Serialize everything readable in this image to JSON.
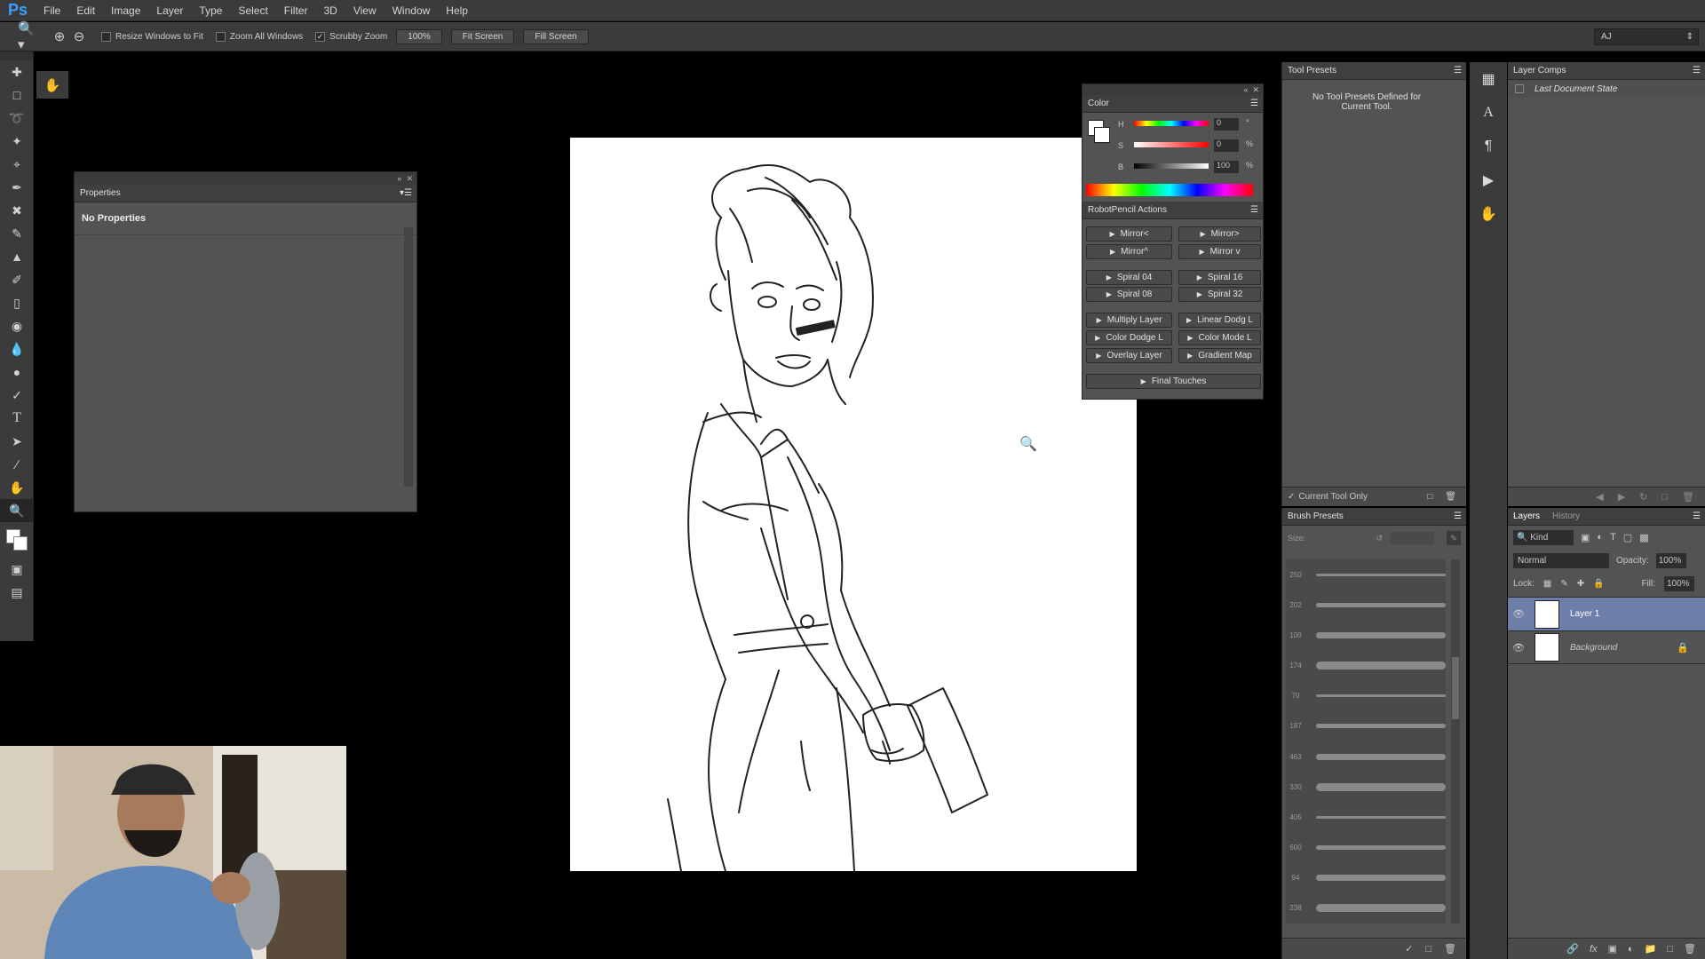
{
  "app": {
    "logo": "Ps"
  },
  "menu": [
    "File",
    "Edit",
    "Image",
    "Layer",
    "Type",
    "Select",
    "Filter",
    "3D",
    "View",
    "Window",
    "Help"
  ],
  "options": {
    "resize_windows": "Resize Windows to Fit",
    "zoom_all": "Zoom All Windows",
    "scrubby_zoom": "Scrubby Zoom",
    "zoom_level": "100%",
    "fit_screen": "Fit Screen",
    "fill_screen": "Fill Screen",
    "workspace": "AJ"
  },
  "properties": {
    "title": "Properties",
    "content": "No Properties"
  },
  "color": {
    "title": "Color",
    "h_label": "H",
    "h_value": "0",
    "h_unit": "°",
    "s_label": "S",
    "s_value": "0",
    "s_unit": "%",
    "b_label": "B",
    "b_value": "100",
    "b_unit": "%"
  },
  "actions": {
    "title": "RobotPencil Actions",
    "buttons": [
      "Mirror<",
      "Mirror>",
      "Mirror^",
      "Mirror v",
      "Spiral 04",
      "Spiral 16",
      "Spiral 08",
      "Spiral 32",
      "Multiply Layer",
      "Linear Dodg L",
      "Color Dodge L",
      "Color Mode L",
      "Overlay Layer",
      "Gradient Map",
      "Final Touches"
    ]
  },
  "tool_presets": {
    "title": "Tool Presets",
    "message": "No Tool Presets Defined for Current Tool.",
    "current_only": "Current Tool Only"
  },
  "brush_presets": {
    "title": "Brush Presets",
    "size_label": "Size:",
    "sizes": [
      "250",
      "202",
      "100",
      "174",
      "70",
      "187",
      "463",
      "330",
      "405",
      "600",
      "94",
      "238"
    ]
  },
  "layer_comps": {
    "title": "Layer Comps",
    "item": "Last Document State"
  },
  "layers": {
    "tab_layers": "Layers",
    "tab_history": "History",
    "kind": "Kind",
    "blend": "Normal",
    "opacity_label": "Opacity:",
    "opacity": "100%",
    "lock_label": "Lock:",
    "fill_label": "Fill:",
    "fill": "100%",
    "items": [
      "Layer 1",
      "Background"
    ]
  },
  "colors": {
    "chrome": "#3b3b3b",
    "panel": "#535353",
    "selected_layer": "#6d7fa8",
    "accent": "#3aa0ff"
  }
}
